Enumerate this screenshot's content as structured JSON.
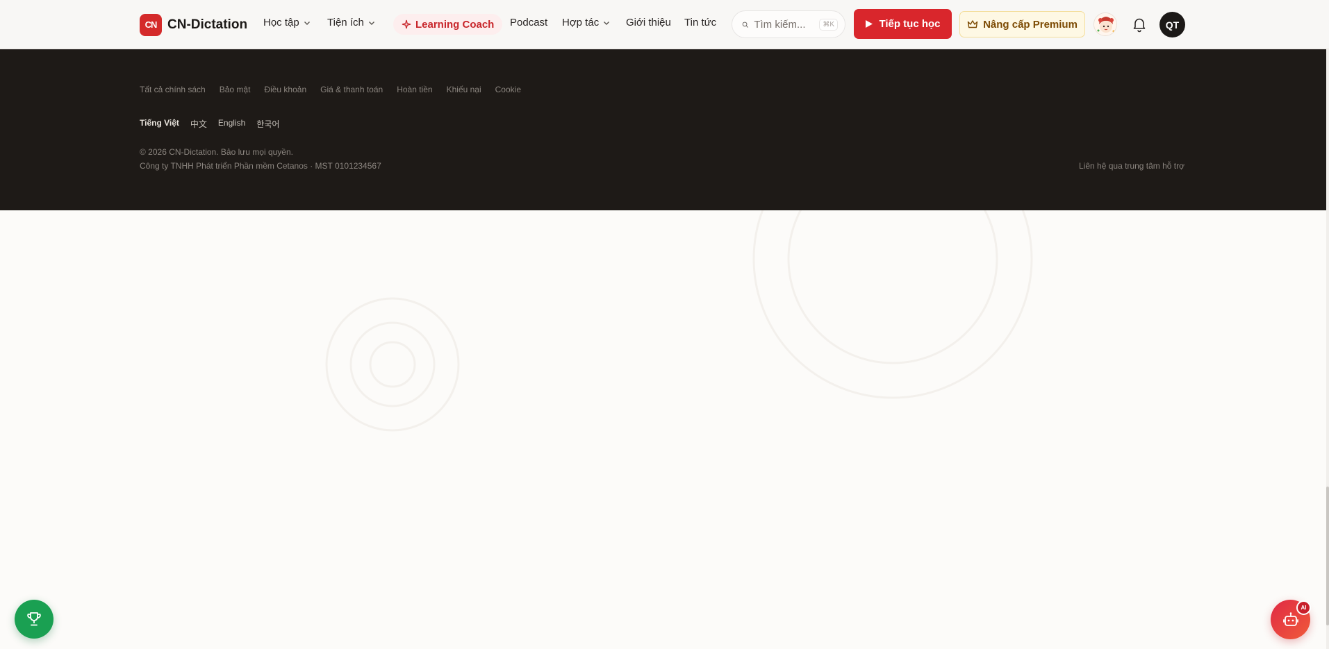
{
  "header": {
    "logo_mark": "CN",
    "logo_text": "CN-Dictation",
    "nav": {
      "hoc_tap": "Học tập",
      "tien_ich": "Tiện ích",
      "learning_coach": "Learning Coach",
      "podcast": "Podcast",
      "hop_tac": "Hợp tác",
      "gioi_thieu": "Giới thiệu",
      "tin_tuc": "Tin tức"
    },
    "search": {
      "placeholder": "Tìm kiếm...",
      "shortcut": "⌘K"
    },
    "continue_label": "Tiếp tục học",
    "premium_label": "Nâng cấp Premium",
    "user_initials": "QT"
  },
  "footer": {
    "policy_links": [
      "Tất cả chính sách",
      "Bảo mật",
      "Điều khoản",
      "Giá & thanh toán",
      "Hoàn tiền",
      "Khiếu nại",
      "Cookie"
    ],
    "languages": [
      "Tiếng Việt",
      "中文",
      "English",
      "한국어"
    ],
    "active_language": "Tiếng Việt",
    "copyright": "© 2026 CN-Dictation. Bảo lưu mọi quyền.",
    "company": "Công ty TNHH Phát triển Phần mềm Cetanos · MST 0101234567",
    "support_link": "Liên hệ qua trung tâm hỗ trợ"
  },
  "fab": {
    "ai_badge": "AI"
  },
  "colors": {
    "brand_red": "#d9262c",
    "footer_bg": "#1e1a17",
    "premium_bg": "#fef8e4",
    "trophy_green": "#1aa052"
  },
  "icons": {
    "logo": "cn-logo-icon",
    "chevron": "chevron-down-icon",
    "sparkle": "sparkle-icon",
    "search": "search-icon",
    "play": "play-icon",
    "crown": "crown-icon",
    "bell": "bell-icon",
    "trophy": "trophy-icon",
    "robot": "robot-icon"
  }
}
